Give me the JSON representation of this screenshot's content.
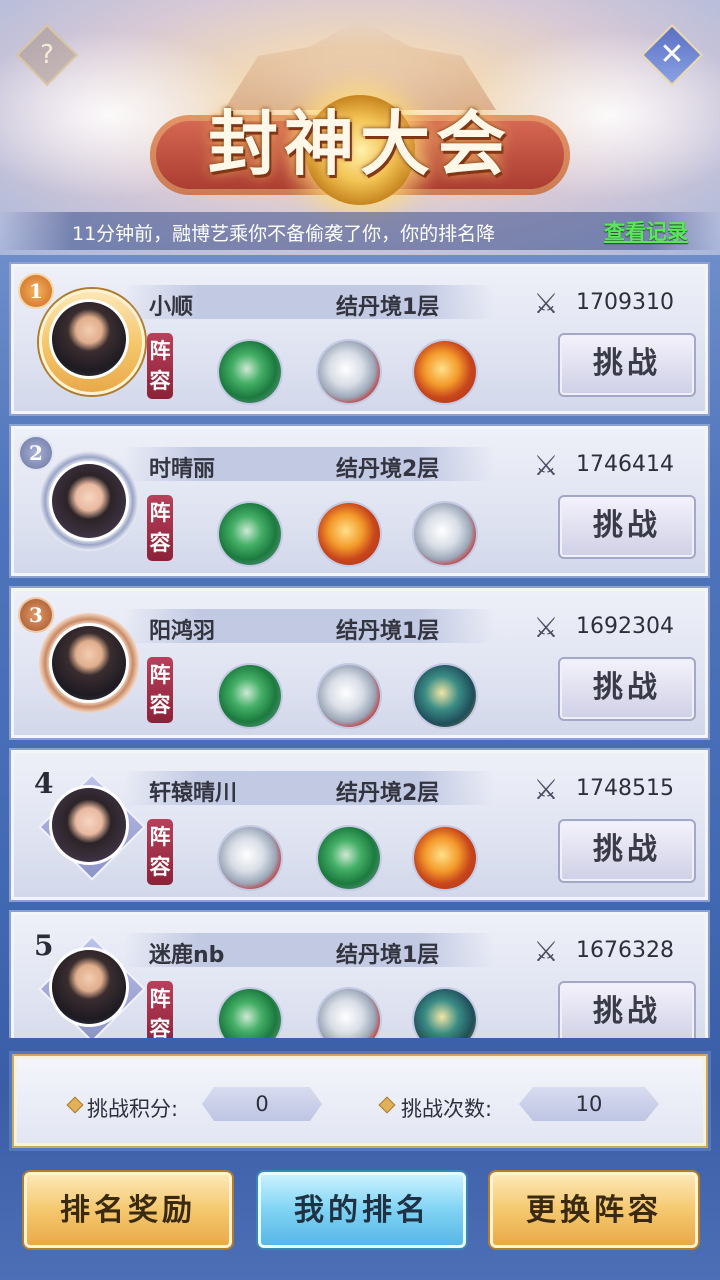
{
  "header": {
    "title": "封神大会",
    "help_icon": "?",
    "close_icon": "✕",
    "notice": "11分钟前，融博艺乘你不备偷袭了你，你的排名降",
    "view_record": "查看记录"
  },
  "players": [
    {
      "rank": "1",
      "name": "小顺",
      "realm": "结丹境1层",
      "power": "1709310",
      "lineup_label": "阵容",
      "beasts": [
        "green-dragon-icon",
        "white-tiger-icon",
        "red-dragon-icon"
      ],
      "challenge": "挑战",
      "frame": "gold",
      "gender": "male"
    },
    {
      "rank": "2",
      "name": "时晴丽",
      "realm": "结丹境2层",
      "power": "1746414",
      "lineup_label": "阵容",
      "beasts": [
        "green-dragon-icon",
        "red-dragon-icon",
        "white-tiger-icon"
      ],
      "challenge": "挑战",
      "frame": "silver",
      "gender": "female"
    },
    {
      "rank": "3",
      "name": "阳鸿羽",
      "realm": "结丹境1层",
      "power": "1692304",
      "lineup_label": "阵容",
      "beasts": [
        "green-dragon-icon",
        "white-tiger-icon",
        "teal-beast-icon"
      ],
      "challenge": "挑战",
      "frame": "bronze",
      "gender": "male"
    },
    {
      "rank": "4",
      "name": "轩辕晴川",
      "realm": "结丹境2层",
      "power": "1748515",
      "lineup_label": "阵容",
      "beasts": [
        "white-tiger-icon",
        "green-dragon-icon",
        "red-dragon-icon"
      ],
      "challenge": "挑战",
      "frame": "diamond",
      "gender": "female"
    },
    {
      "rank": "5",
      "name": "迷鹿nb",
      "realm": "结丹境1层",
      "power": "1676328",
      "lineup_label": "阵容",
      "beasts": [
        "green-dragon-icon",
        "white-tiger-icon",
        "teal-beast-icon"
      ],
      "challenge": "挑战",
      "frame": "diamond",
      "gender": "male"
    }
  ],
  "stats": {
    "points_label": "挑战积分:",
    "points_value": "0",
    "count_label": "挑战次数:",
    "count_value": "10"
  },
  "buttons": {
    "rank_reward": "排名奖励",
    "my_rank": "我的排名",
    "change_lineup": "更换阵容"
  }
}
